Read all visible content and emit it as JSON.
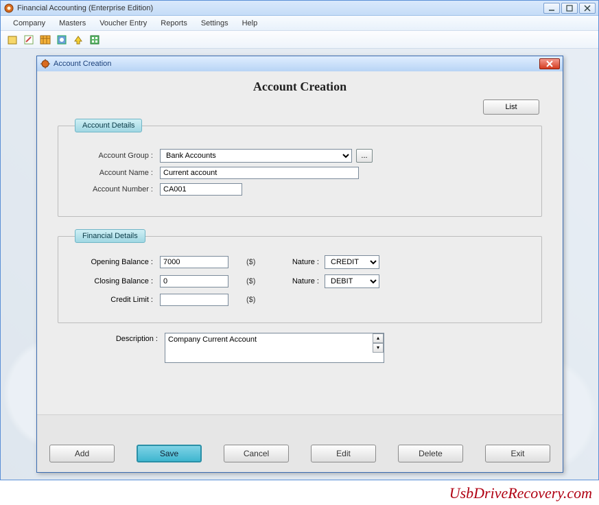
{
  "app": {
    "title": "Financial Accounting (Enterprise Edition)"
  },
  "menu": {
    "items": [
      "Company",
      "Masters",
      "Voucher Entry",
      "Reports",
      "Settings",
      "Help"
    ]
  },
  "dialog": {
    "title": "Account Creation",
    "heading": "Account Creation",
    "list_button": "List",
    "groups": {
      "account_details": {
        "legend": "Account Details",
        "account_group_label": "Account Group :",
        "account_group_value": "Bank Accounts",
        "account_name_label": "Account Name :",
        "account_name_value": "Current account",
        "account_number_label": "Account Number :",
        "account_number_value": "CA001"
      },
      "financial_details": {
        "legend": "Financial Details",
        "opening_balance_label": "Opening Balance :",
        "opening_balance_value": "7000",
        "opening_balance_unit": "($)",
        "opening_nature_label": "Nature :",
        "opening_nature_value": "CREDIT",
        "closing_balance_label": "Closing Balance :",
        "closing_balance_value": "0",
        "closing_balance_unit": "($)",
        "closing_nature_label": "Nature :",
        "closing_nature_value": "DEBIT",
        "credit_limit_label": "Credit Limit :",
        "credit_limit_value": "",
        "credit_limit_unit": "($)"
      }
    },
    "description_label": "Description :",
    "description_value": "Company Current Account",
    "buttons": {
      "add": "Add",
      "save": "Save",
      "cancel": "Cancel",
      "edit": "Edit",
      "delete": "Delete",
      "exit": "Exit"
    },
    "browse_label": "..."
  },
  "watermark": "UsbDriveRecovery.com",
  "icons": {
    "app": "app-icon",
    "dialog": "gear-icon"
  }
}
